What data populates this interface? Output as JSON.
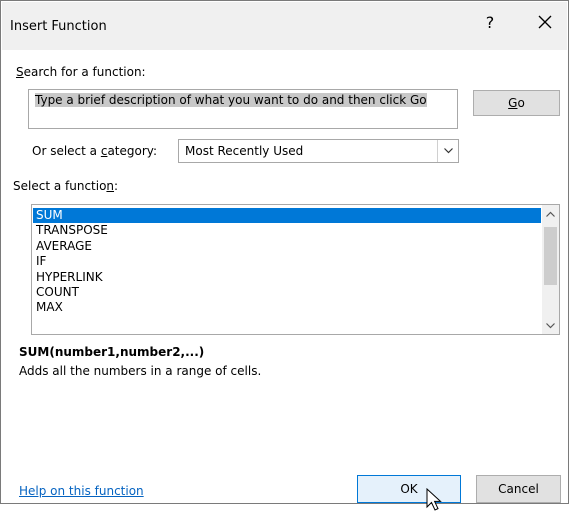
{
  "dialog": {
    "title": "Insert Function",
    "help_glyph": "?",
    "close_icon": "close-icon"
  },
  "search": {
    "label_pre": "",
    "label_key": "S",
    "label_post": "earch for a function:",
    "value": "Type a brief description of what you want to do and then click Go",
    "go_key": "G",
    "go_rest": "o"
  },
  "category": {
    "label_pre": "Or select a ",
    "label_key": "c",
    "label_post": "ategory:",
    "selected": "Most Recently Used"
  },
  "functions": {
    "label_pre": "Select a functio",
    "label_key": "n",
    "label_post": ":",
    "items": [
      "SUM",
      "TRANSPOSE",
      "AVERAGE",
      "IF",
      "HYPERLINK",
      "COUNT",
      "MAX"
    ],
    "selected_index": 0
  },
  "details": {
    "syntax": "SUM(number1,number2,...)",
    "description": "Adds all the numbers in a range of cells."
  },
  "footer": {
    "help_link": "Help on this function",
    "ok_label": "OK",
    "cancel_label": "Cancel"
  },
  "colors": {
    "accent": "#0078d7",
    "link": "#0563c1",
    "titlebar": "#f0f0f0"
  }
}
